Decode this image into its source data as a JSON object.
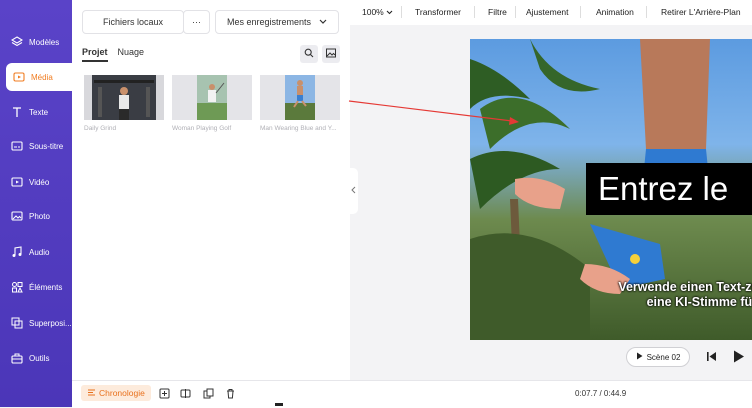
{
  "sidebar": {
    "items": [
      {
        "label": "Modèles",
        "icon": "layers-icon"
      },
      {
        "label": "Média",
        "icon": "media-folder-icon",
        "active": true
      },
      {
        "label": "Texte",
        "icon": "text-icon"
      },
      {
        "label": "Sous-titre",
        "icon": "subtitle-icon"
      },
      {
        "label": "Vidéo",
        "icon": "video-icon"
      },
      {
        "label": "Photo",
        "icon": "photo-icon"
      },
      {
        "label": "Audio",
        "icon": "music-icon"
      },
      {
        "label": "Éléments",
        "icon": "shapes-icon"
      },
      {
        "label": "Superposi...",
        "icon": "overlay-icon"
      },
      {
        "label": "Outils",
        "icon": "toolbox-icon"
      }
    ]
  },
  "media_panel": {
    "local_files_label": "Fichiers locaux",
    "more_label": "···",
    "recordings_label": "Mes enregistrements",
    "tabs": [
      {
        "label": "Projet",
        "active": true
      },
      {
        "label": "Nuage",
        "active": false
      }
    ],
    "thumbnails": [
      {
        "caption": "Daily Grind"
      },
      {
        "caption": "Woman Playing Golf"
      },
      {
        "caption": "Man Wearing Blue and Y..."
      }
    ]
  },
  "toolbar": {
    "zoom": "100%",
    "items": [
      "Transformer",
      "Filtre",
      "Ajustement",
      "Animation",
      "Retirer L'Arrière-Plan"
    ]
  },
  "canvas": {
    "headline": "Entrez le",
    "subtitle_line1": "Verwende einen Text-zu-Sprac",
    "subtitle_line2": "eine KI-Stimme für dein V"
  },
  "player": {
    "scene_label": "Scène 02"
  },
  "bottom": {
    "timeline_label": "Chronologie",
    "timecode": "0:07.7 / 0:44.9"
  },
  "colors": {
    "sidebar": "#4f3abf",
    "accent": "#f07d22",
    "annotation_arrow": "#e53935"
  }
}
